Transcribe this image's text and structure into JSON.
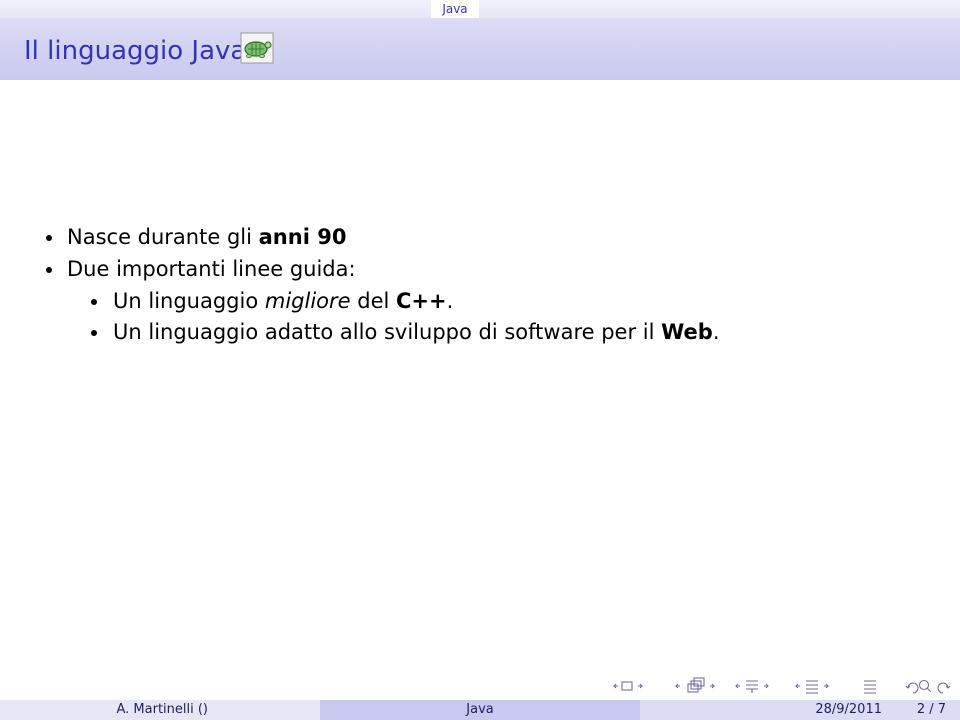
{
  "header": {
    "section_tab": "Java",
    "frame_title": "Il linguaggio Java"
  },
  "bullets": {
    "b1_pre": "Nasce durante gli ",
    "b1_bold": "anni 90",
    "b2": "Due importanti linee guida:",
    "s1_pre": "Un linguaggio ",
    "s1_ital": "migliore",
    "s1_mid": " del ",
    "s1_bold": "C++",
    "s1_end": ".",
    "s2_pre": "Un linguaggio adatto allo sviluppo di software per il ",
    "s2_bold": "Web",
    "s2_end": "."
  },
  "footer": {
    "author": "A. Martinelli  ()",
    "title": "Java",
    "date": "28/9/2011",
    "page": "2 / 7"
  },
  "colors": {
    "beamer_blue": "#3333b3",
    "title_bg": "#c9c9ef",
    "footer_mid": "#c9c9ef"
  },
  "icons": {
    "logo": "turtle-logo-icon",
    "nav": [
      "nav-prev-frame-icon",
      "nav-frame-icon",
      "nav-next-frame-icon",
      "nav-prev-subsection-icon",
      "nav-subsection-icon",
      "nav-next-subsection-icon",
      "nav-prev-section-icon",
      "nav-section-icon",
      "nav-next-section-icon",
      "nav-prev-slide-icon",
      "nav-slide-icon",
      "nav-next-slide-icon",
      "nav-align-icon",
      "nav-back-icon",
      "nav-search-icon",
      "nav-forward-icon"
    ]
  }
}
